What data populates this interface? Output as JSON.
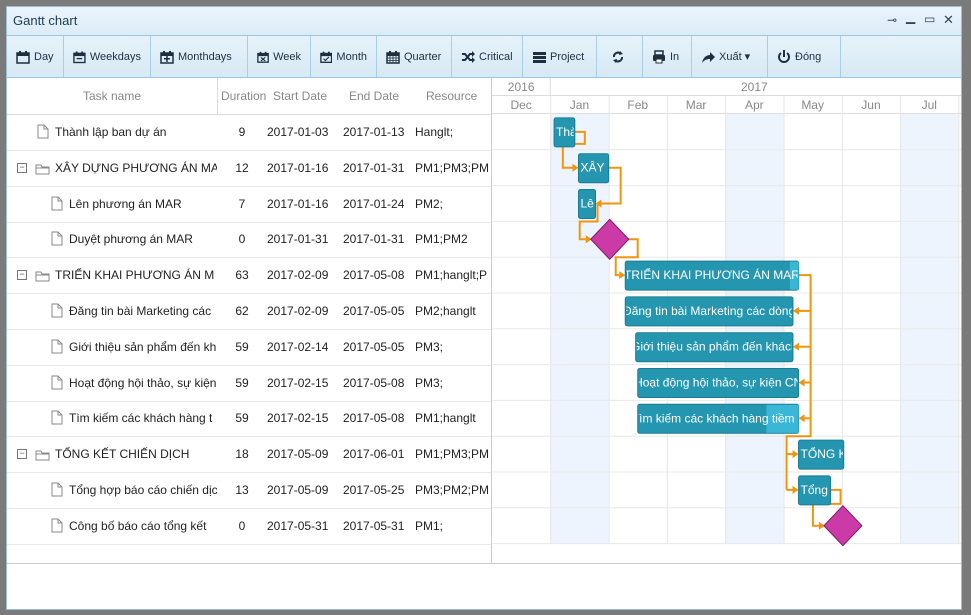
{
  "window": {
    "title": "Gantt chart",
    "controls": [
      "pin",
      "minimize",
      "maximize",
      "close"
    ]
  },
  "toolbar": [
    {
      "label": "Day",
      "icon": "calendar-icon"
    },
    {
      "label": "Weekdays",
      "icon": "calendar-minus-icon"
    },
    {
      "label": "Monthdays",
      "icon": "calendar-plus-icon"
    },
    {
      "label": "Week",
      "icon": "calendar-x-icon"
    },
    {
      "label": "Month",
      "icon": "calendar-check-icon"
    },
    {
      "label": "Quarter",
      "icon": "calendar-grid-icon"
    },
    {
      "label": "Critical",
      "icon": "shuffle-icon"
    },
    {
      "label": "Project",
      "icon": "server-icon"
    },
    {
      "label": "",
      "icon": "refresh-icon"
    },
    {
      "label": "In",
      "icon": "print-icon"
    },
    {
      "label": "Xuất ▾",
      "icon": "share-icon"
    },
    {
      "label": "Đóng",
      "icon": "power-icon"
    }
  ],
  "grid": {
    "columns": [
      "Task name",
      "Duration",
      "Start Date",
      "End Date",
      "Resource"
    ],
    "rows": [
      {
        "name": "Thành lập ban dự án",
        "duration": "9",
        "start": "2017-01-03",
        "end": "2017-01-13",
        "resource": "Hanglt;",
        "type": "task",
        "level": 0
      },
      {
        "name": "XÂY DỰNG PHƯƠNG ÁN MA",
        "duration": "12",
        "start": "2017-01-16",
        "end": "2017-01-31",
        "resource": "PM1;PM3;PM",
        "type": "group",
        "level": 0
      },
      {
        "name": "Lên phương án MAR",
        "duration": "7",
        "start": "2017-01-16",
        "end": "2017-01-24",
        "resource": "PM2;",
        "type": "task",
        "level": 1
      },
      {
        "name": "Duyệt phương án MAR",
        "duration": "0",
        "start": "2017-01-31",
        "end": "2017-01-31",
        "resource": "PM1;PM2",
        "type": "task",
        "level": 1
      },
      {
        "name": "TRIỂN KHAI PHƯƠNG ÁN M",
        "duration": "63",
        "start": "2017-02-09",
        "end": "2017-05-08",
        "resource": "PM1;hanglt;P",
        "type": "group",
        "level": 0
      },
      {
        "name": "Đăng tin bài Marketing các",
        "duration": "62",
        "start": "2017-02-09",
        "end": "2017-05-05",
        "resource": "PM2;hanglt",
        "type": "task",
        "level": 1
      },
      {
        "name": "Giới thiệu sản phẩm đến kh",
        "duration": "59",
        "start": "2017-02-14",
        "end": "2017-05-05",
        "resource": "PM3;",
        "type": "task",
        "level": 1
      },
      {
        "name": "Hoạt động hội thảo, sự kiện",
        "duration": "59",
        "start": "2017-02-15",
        "end": "2017-05-08",
        "resource": "PM3;",
        "type": "task",
        "level": 1
      },
      {
        "name": "Tìm kiếm các khách hàng t",
        "duration": "59",
        "start": "2017-02-15",
        "end": "2017-05-08",
        "resource": "PM1;hanglt",
        "type": "task",
        "level": 1
      },
      {
        "name": "TỔNG KẾT CHIẾN DỊCH",
        "duration": "18",
        "start": "2017-05-09",
        "end": "2017-06-01",
        "resource": "PM1;PM3;PM",
        "type": "group",
        "level": 0
      },
      {
        "name": "Tổng hợp báo cáo chiến dịc",
        "duration": "13",
        "start": "2017-05-09",
        "end": "2017-05-25",
        "resource": "PM3;PM2;PM",
        "type": "task",
        "level": 1
      },
      {
        "name": "Công bố báo cáo tổng kết",
        "duration": "0",
        "start": "2017-05-31",
        "end": "2017-05-31",
        "resource": "PM1;",
        "type": "task",
        "level": 1
      }
    ]
  },
  "timeline": {
    "years": [
      {
        "label": "2016"
      },
      {
        "label": "2017"
      }
    ],
    "months": [
      "Dec",
      "Jan",
      "Feb",
      "Mar",
      "Apr",
      "May",
      "Jun",
      "Jul"
    ]
  },
  "bars": [
    {
      "label": "Thà",
      "kind": "task"
    },
    {
      "label": "XÂY D",
      "kind": "task"
    },
    {
      "label": "Lên",
      "kind": "task"
    },
    {
      "label": "",
      "kind": "milestone"
    },
    {
      "label": "TRIỂN KHAI PHƯƠNG ÁN MAR",
      "kind": "task",
      "progress": 0.05
    },
    {
      "label": "Đăng tin bài Marketing các dòng",
      "kind": "task"
    },
    {
      "label": "Giới thiệu sản phẩm đến khách",
      "kind": "task"
    },
    {
      "label": "Hoạt động hội thảo, sự kiện CN",
      "kind": "task"
    },
    {
      "label": "Tìm kiếm các khách hàng tiềm n",
      "kind": "task",
      "progress": 0.2
    },
    {
      "label": "TỔNG KẾ",
      "kind": "task"
    },
    {
      "label": "Tổng h",
      "kind": "task"
    },
    {
      "label": "",
      "kind": "milestone"
    }
  ],
  "colors": {
    "bar": "#2596b0",
    "bar_border": "#1a7c93",
    "progress": "#3ab7d6",
    "milestone": "#cc3aa8",
    "link": "#f0950f",
    "weekend_band": "#eef4fd"
  }
}
